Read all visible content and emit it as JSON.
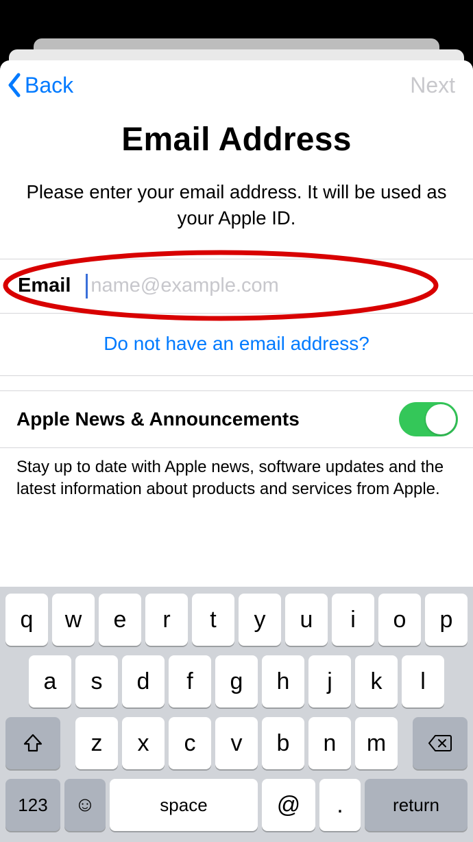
{
  "nav": {
    "back": "Back",
    "next": "Next"
  },
  "header": {
    "title": "Email Address",
    "subtitle": "Please enter your email address. It will be used as your Apple ID."
  },
  "email_field": {
    "label": "Email",
    "placeholder": "name@example.com",
    "value": ""
  },
  "links": {
    "no_email": "Do not have an email address?"
  },
  "news_toggle": {
    "label": "Apple News & Announcements",
    "on": true,
    "description": "Stay up to date with Apple news, software updates and the latest information about products and services from Apple."
  },
  "keyboard": {
    "row1": [
      "q",
      "w",
      "e",
      "r",
      "t",
      "y",
      "u",
      "i",
      "o",
      "p"
    ],
    "row2": [
      "a",
      "s",
      "d",
      "f",
      "g",
      "h",
      "j",
      "k",
      "l"
    ],
    "row3": [
      "z",
      "x",
      "c",
      "v",
      "b",
      "n",
      "m"
    ],
    "num_key": "123",
    "space_key": "space",
    "at_key": "@",
    "dot_key": ".",
    "return_key": "return"
  }
}
